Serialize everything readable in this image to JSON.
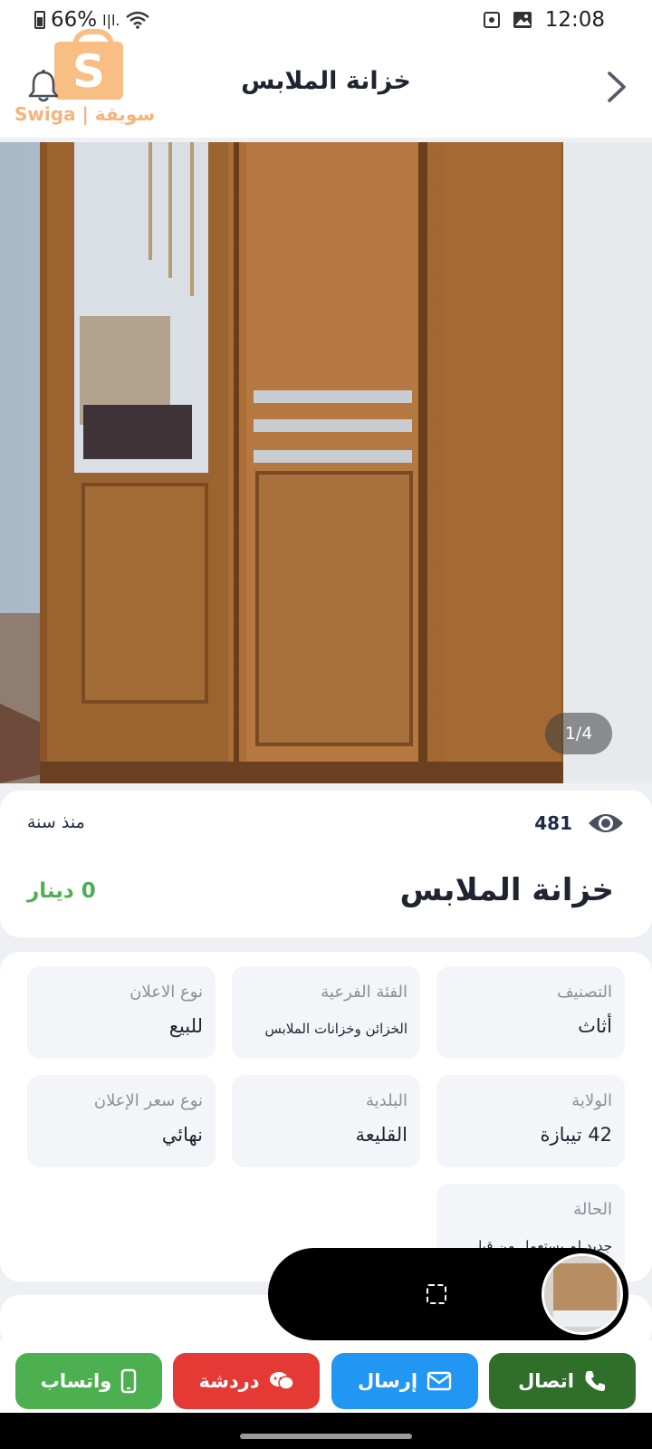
{
  "status_bar": {
    "battery": "66%",
    "signal": "l|l.",
    "time": "12:08"
  },
  "header": {
    "title": "خزانة الملابس",
    "logo_text": "Swiga | سويقة",
    "logo_letter": "S"
  },
  "gallery": {
    "counter": "1/4"
  },
  "summary": {
    "posted_ago": "منذ سنة",
    "views": "481",
    "title": "خزانة الملابس",
    "price": "0 دينار"
  },
  "details": {
    "category_label": "التصنيف",
    "category_value": "أثاث",
    "subcategory_label": "الفئة الفرعية",
    "subcategory_value": "الخزائن وخزانات الملابس",
    "ad_type_label": "نوع الاعلان",
    "ad_type_value": "للبيع",
    "state_label": "الولاية",
    "state_value": "42 تيبازة",
    "municipality_label": "البلدية",
    "municipality_value": "القليعة",
    "price_type_label": "نوع سعر الإعلان",
    "price_type_value": "نهائي",
    "condition_label": "الحالة",
    "condition_value": "جديد لم يستعمل من قبل"
  },
  "actions": {
    "call": "اتصال",
    "send": "إرسال",
    "chat": "دردشة",
    "whatsapp": "واتساب"
  },
  "colors": {
    "call": "#2f6f2a",
    "send": "#2196f3",
    "chat": "#e53935",
    "whatsapp": "#4caf50",
    "price": "#4caf50",
    "logo": "#f39a4e"
  }
}
